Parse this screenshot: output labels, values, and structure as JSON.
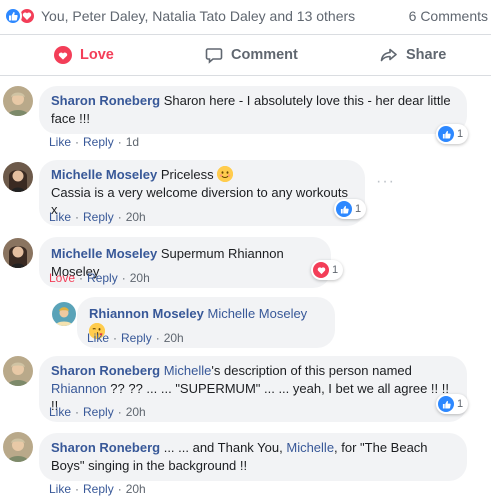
{
  "summary": {
    "names": "You, Peter Daley, Natalia Tato Daley and 13 others",
    "comment_count": "6 Comments"
  },
  "actions": {
    "love": "Love",
    "comment": "Comment",
    "share": "Share"
  },
  "comments": [
    {
      "author": "Sharon Roneberg",
      "text": "Sharon here - I absolutely love this - her dear little face !!!",
      "reaction_label": "Like",
      "reply_label": "Reply",
      "time": "1d",
      "reaction_count": "1",
      "reaction_type": "like"
    },
    {
      "author": "Michelle Moseley",
      "text_line1": "Priceless",
      "text_line2": "Cassia is a very welcome diversion to any workouts x",
      "reaction_label": "Like",
      "reply_label": "Reply",
      "time": "20h",
      "reaction_count": "1",
      "reaction_type": "like",
      "more": "···"
    },
    {
      "author": "Michelle Moseley",
      "text": "Supermum Rhiannon Moseley",
      "reaction_label": "Love",
      "reply_label": "Reply",
      "time": "20h",
      "reaction_count": "1",
      "reaction_type": "love"
    },
    {
      "author": "Rhiannon Moseley",
      "mention": "Michelle Moseley",
      "reaction_label": "Like",
      "reply_label": "Reply",
      "time": "20h"
    },
    {
      "author": "Sharon Roneberg",
      "mention1": "Michelle",
      "text1": "'s description of this person named",
      "mention2": "Rhiannon",
      "text2": "?? ?? ... ... \"SUPERMUM\" ... ... yeah, I bet we all agree !! !! !!",
      "reaction_label": "Like",
      "reply_label": "Reply",
      "time": "20h",
      "reaction_count": "1",
      "reaction_type": "like"
    },
    {
      "author": "Sharon Roneberg",
      "text1": "... ... and Thank You,",
      "mention": "Michelle",
      "text2": ", for \"The Beach Boys\" singing in the background !!",
      "reaction_label": "Like",
      "reply_label": "Reply",
      "time": "20h"
    }
  ],
  "colors": {
    "link": "#385898",
    "love": "#f33e58",
    "like": "#2d88ff",
    "bubble": "#f2f3f5",
    "muted": "#606770"
  }
}
